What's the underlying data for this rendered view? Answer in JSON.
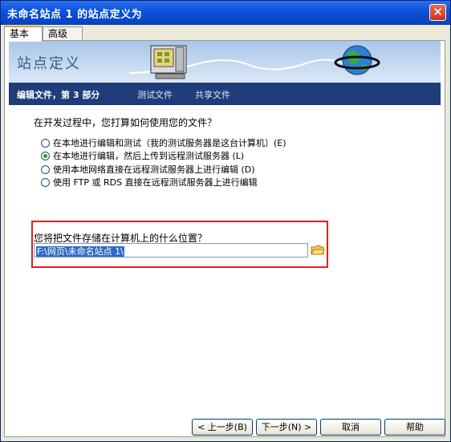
{
  "window": {
    "title": "未命名站点 1 的站点定义为",
    "close_glyph": "✕"
  },
  "tabs": [
    {
      "label": "基本",
      "active": true
    },
    {
      "label": "高级",
      "active": false
    }
  ],
  "banner": {
    "title": "站点定义"
  },
  "steps": [
    {
      "label": "编辑文件，第 3 部分",
      "active": true
    },
    {
      "label": "测试文件",
      "active": false
    },
    {
      "label": "共享文件",
      "active": false
    }
  ],
  "question": "在开发过程中，您打算如何使用您的文件？",
  "options": [
    {
      "label": "在本地进行编辑和测试（我的测试服务器是这台计算机）(E)",
      "checked": false
    },
    {
      "label": "在本地进行编辑，然后上传到远程测试服务器 (L)",
      "checked": true
    },
    {
      "label": "使用本地网络直接在远程测试服务器上进行编辑 (D)",
      "checked": false
    },
    {
      "label": "使用 FTP 或 RDS 直接在远程测试服务器上进行编辑",
      "checked": false
    }
  ],
  "location": {
    "label": "您将把文件存储在计算机上的什么位置？",
    "value": "F:\\网页\\未命名站点 1\\",
    "browse_icon": "folder-icon"
  },
  "buttons": {
    "back": "< 上一步(B)",
    "next": "下一步(N) >",
    "cancel": "取消",
    "help": "帮助"
  },
  "colors": {
    "title_bar": "#0a51d8",
    "steps_bar": "#1e3d7a",
    "highlight_border": "#e02020",
    "selection": "#316ac5"
  }
}
